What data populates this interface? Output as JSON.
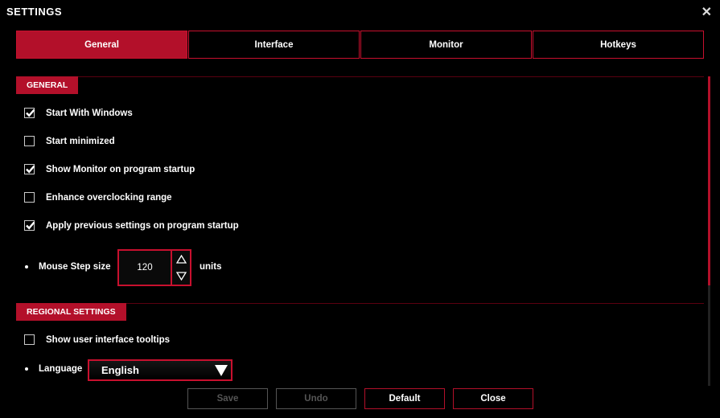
{
  "window": {
    "title": "SETTINGS",
    "close_glyph": "✕"
  },
  "tabs": [
    {
      "label": "General",
      "active": true
    },
    {
      "label": "Interface",
      "active": false
    },
    {
      "label": "Monitor",
      "active": false
    },
    {
      "label": "Hotkeys",
      "active": false
    }
  ],
  "general": {
    "title": "GENERAL",
    "options": [
      {
        "label": "Start With Windows",
        "checked": true
      },
      {
        "label": "Start minimized",
        "checked": false
      },
      {
        "label": "Show Monitor on program startup",
        "checked": true
      },
      {
        "label": "Enhance overclocking range",
        "checked": false
      },
      {
        "label": "Apply previous settings on program startup",
        "checked": true
      }
    ],
    "mouse_step": {
      "label": "Mouse Step size",
      "value": "120",
      "units": "units"
    }
  },
  "regional": {
    "title": "REGIONAL SETTINGS",
    "tooltips": {
      "label": "Show user interface tooltips",
      "checked": false
    },
    "language": {
      "label": "Language",
      "value": "English"
    }
  },
  "buttons": {
    "save": "Save",
    "undo": "Undo",
    "default": "Default",
    "close": "Close"
  },
  "colors": {
    "accent": "#b3102a",
    "background": "#000000"
  },
  "icons": {
    "checkbox_checked": "checkmark-icon",
    "step_up": "triangle-up-icon",
    "step_down": "triangle-down-icon",
    "dropdown": "triangle-down-icon"
  }
}
